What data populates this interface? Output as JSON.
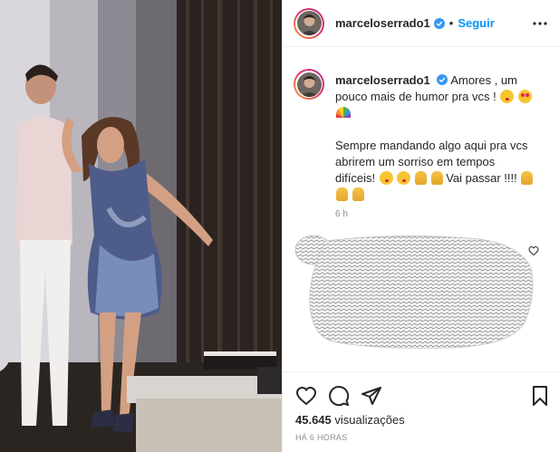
{
  "post": {
    "username": "marceloserrado1",
    "follow_label": "Seguir",
    "separator": "•"
  },
  "caption": {
    "username": "marceloserrado1",
    "line1": "Amores , um",
    "line2": "pouco mais de humor pra vcs !",
    "line3": "Sempre mandando algo aqui pra vcs",
    "line4": "abrirem um sorriso em tempos",
    "line5": "difíceis!",
    "line5b": "Vai passar !!!!",
    "time": "6 h"
  },
  "footer": {
    "views_count": "45.645",
    "views_label": "visualizações",
    "posted_ago": "HÁ 6 HORAS"
  },
  "icons": {
    "verified": "verified-badge-icon",
    "more": "more-options-icon",
    "like": "heart-icon",
    "comment": "comment-icon",
    "share": "paper-plane-icon",
    "save": "bookmark-icon"
  },
  "colors": {
    "accent": "#0095f6",
    "text": "#262626",
    "muted": "#8e8e8e"
  }
}
